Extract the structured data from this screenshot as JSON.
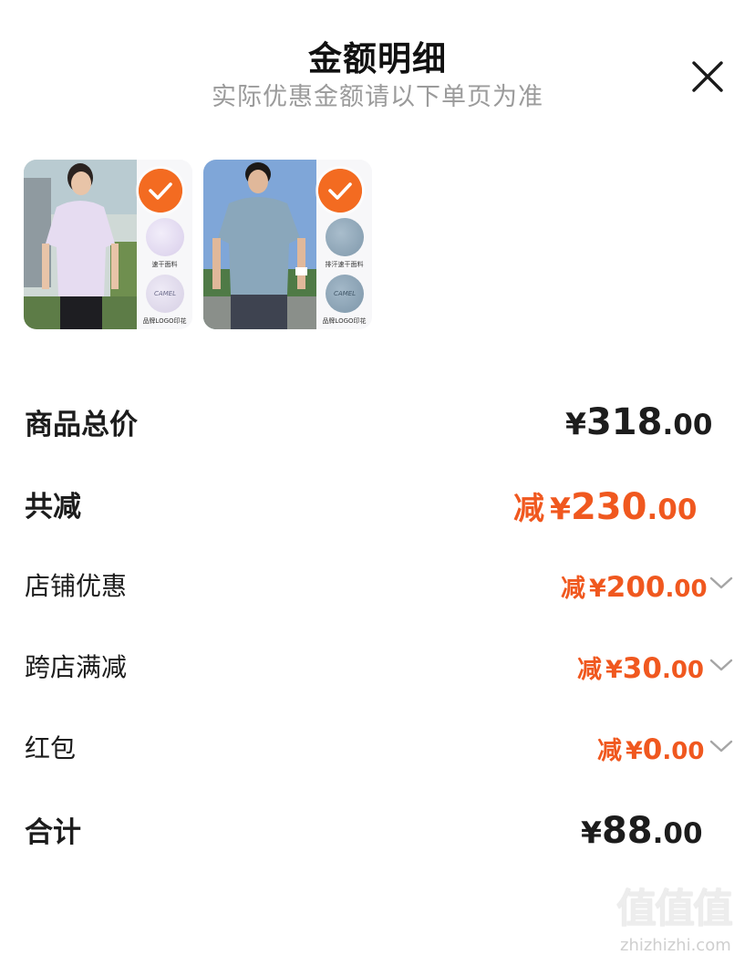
{
  "header": {
    "title": "金额明细",
    "subtitle": "实际优惠金额请以下单页为准"
  },
  "products": [
    {
      "shirt_color": "#e6dcf1",
      "feature1_label": "速干面料",
      "feature2_label": "品牌LOGO印花",
      "logo_text": "CAMEL",
      "selected": true
    },
    {
      "shirt_color": "#8aa7bb",
      "feature1_label": "排汗速干面料",
      "feature2_label": "品牌LOGO印花",
      "logo_text": "CAMEL",
      "selected": true
    }
  ],
  "summary": {
    "subtotal": {
      "label": "商品总价",
      "yen": "¥",
      "int": "318",
      "dec": ".00"
    },
    "total_discount": {
      "label": "共减",
      "prefix": "减",
      "yen": "¥",
      "int": "230",
      "dec": ".00"
    },
    "shop_discount": {
      "label": "店铺优惠",
      "prefix": "减",
      "yen": "¥",
      "int": "200",
      "dec": ".00"
    },
    "cross_shop": {
      "label": "跨店满减",
      "prefix": "减",
      "yen": "¥",
      "int": "30",
      "dec": ".00"
    },
    "red_packet": {
      "label": "红包",
      "prefix": "减",
      "yen": "¥",
      "int": "0",
      "dec": ".00"
    },
    "total": {
      "label": "合计",
      "yen": "¥",
      "int": "88",
      "dec": ".00"
    }
  },
  "watermark": {
    "glyphs": "值值值",
    "url": "zhizhizhi.com"
  },
  "colors": {
    "accent": "#f0581f",
    "check": "#f36b21",
    "muted": "#9b9b9b"
  }
}
